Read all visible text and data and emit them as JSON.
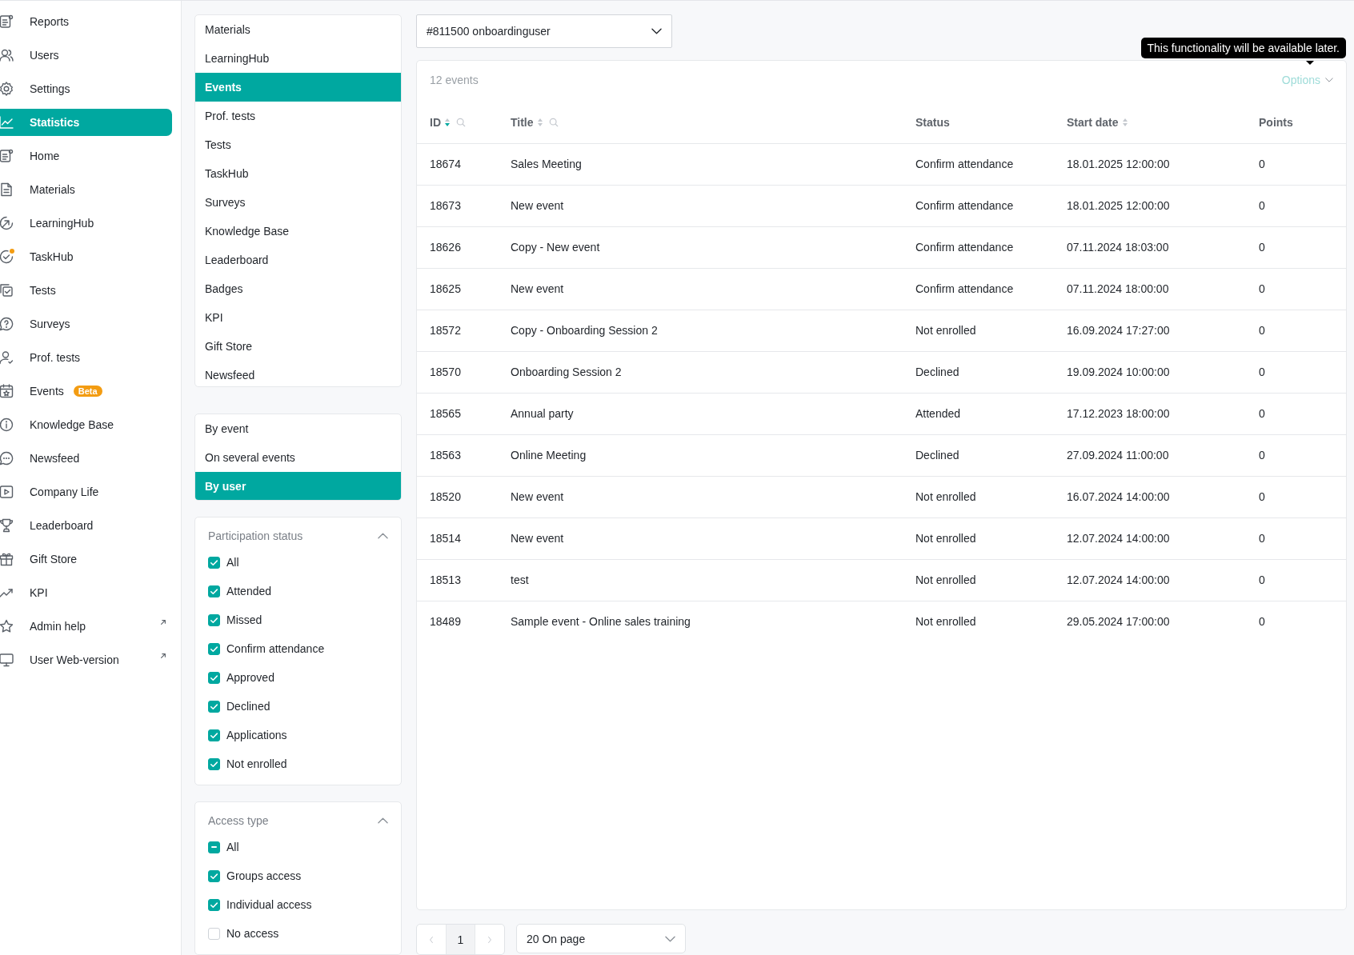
{
  "sidebar": {
    "items": [
      {
        "label": "Reports",
        "selected": false
      },
      {
        "label": "Users",
        "selected": false
      },
      {
        "label": "Settings",
        "selected": false
      },
      {
        "label": "Statistics",
        "selected": true
      },
      {
        "label": "Home",
        "selected": false
      },
      {
        "label": "Materials",
        "selected": false
      },
      {
        "label": "LearningHub",
        "selected": false
      },
      {
        "label": "TaskHub",
        "selected": false,
        "notification": true
      },
      {
        "label": "Tests",
        "selected": false
      },
      {
        "label": "Surveys",
        "selected": false
      },
      {
        "label": "Prof. tests",
        "selected": false
      },
      {
        "label": "Events",
        "selected": false,
        "badge": "Beta"
      },
      {
        "label": "Knowledge Base",
        "selected": false
      },
      {
        "label": "Newsfeed",
        "selected": false
      },
      {
        "label": "Company Life",
        "selected": false
      },
      {
        "label": "Leaderboard",
        "selected": false
      },
      {
        "label": "Gift Store",
        "selected": false
      },
      {
        "label": "KPI",
        "selected": false
      },
      {
        "label": "Admin help",
        "selected": false,
        "external": true
      },
      {
        "label": "User Web-version",
        "selected": false,
        "external": true
      }
    ]
  },
  "sections": {
    "items": [
      {
        "label": "Materials",
        "selected": false
      },
      {
        "label": "LearningHub",
        "selected": false
      },
      {
        "label": "Events",
        "selected": true
      },
      {
        "label": "Prof. tests",
        "selected": false
      },
      {
        "label": "Tests",
        "selected": false
      },
      {
        "label": "TaskHub",
        "selected": false
      },
      {
        "label": "Surveys",
        "selected": false
      },
      {
        "label": "Knowledge Base",
        "selected": false
      },
      {
        "label": "Leaderboard",
        "selected": false
      },
      {
        "label": "Badges",
        "selected": false
      },
      {
        "label": "KPI",
        "selected": false
      },
      {
        "label": "Gift Store",
        "selected": false
      },
      {
        "label": "Newsfeed",
        "selected": false
      }
    ]
  },
  "report_modes": {
    "items": [
      {
        "label": "By event",
        "selected": false
      },
      {
        "label": "On several events",
        "selected": false
      },
      {
        "label": "By user",
        "selected": true
      }
    ]
  },
  "filters": [
    {
      "title": "Participation status",
      "expanded": true,
      "options": [
        {
          "label": "All",
          "checked": true,
          "indeterminate": false
        },
        {
          "label": "Attended",
          "checked": true,
          "indeterminate": false
        },
        {
          "label": "Missed",
          "checked": true,
          "indeterminate": false
        },
        {
          "label": "Confirm attendance",
          "checked": true,
          "indeterminate": false
        },
        {
          "label": "Approved",
          "checked": true,
          "indeterminate": false
        },
        {
          "label": "Declined",
          "checked": true,
          "indeterminate": false
        },
        {
          "label": "Applications",
          "checked": true,
          "indeterminate": false
        },
        {
          "label": "Not enrolled",
          "checked": true,
          "indeterminate": false
        }
      ]
    },
    {
      "title": "Access type",
      "expanded": true,
      "options": [
        {
          "label": "All",
          "checked": false,
          "indeterminate": true
        },
        {
          "label": "Groups access",
          "checked": true,
          "indeterminate": false
        },
        {
          "label": "Individual access",
          "checked": true,
          "indeterminate": false
        },
        {
          "label": "No access",
          "checked": false,
          "indeterminate": false
        }
      ]
    }
  ],
  "user_select": {
    "value": "#811500 onboardinguser"
  },
  "table": {
    "count": "12 events",
    "options": {
      "label": "Options",
      "disabled": true
    },
    "tooltip": "This functionality will be available later.",
    "columns": [
      {
        "label": "ID",
        "sortable": true,
        "sorted": true,
        "searchable": true
      },
      {
        "label": "Title",
        "sortable": true,
        "sorted": false,
        "searchable": true
      },
      {
        "label": "Status",
        "sortable": false,
        "searchable": false
      },
      {
        "label": "Start date",
        "sortable": true,
        "sorted": false,
        "searchable": false
      },
      {
        "label": "Points",
        "sortable": false,
        "searchable": false
      }
    ],
    "rows": [
      [
        "18674",
        "Sales Meeting",
        "Confirm attendance",
        "18.01.2025 12:00:00",
        "0"
      ],
      [
        "18673",
        "New event",
        "Confirm attendance",
        "18.01.2025 12:00:00",
        "0"
      ],
      [
        "18626",
        "Copy - New event",
        "Confirm attendance",
        "07.11.2024 18:03:00",
        "0"
      ],
      [
        "18625",
        "New event",
        "Confirm attendance",
        "07.11.2024 18:00:00",
        "0"
      ],
      [
        "18572",
        "Copy - Onboarding Session 2",
        "Not enrolled",
        "16.09.2024 17:27:00",
        "0"
      ],
      [
        "18570",
        "Onboarding Session 2",
        "Declined",
        "19.09.2024 10:00:00",
        "0"
      ],
      [
        "18565",
        "Annual party",
        "Attended",
        "17.12.2023 18:00:00",
        "0"
      ],
      [
        "18563",
        "Online Meeting",
        "Declined",
        "27.09.2024 11:00:00",
        "0"
      ],
      [
        "18520",
        "New event",
        "Not enrolled",
        "16.07.2024 14:00:00",
        "0"
      ],
      [
        "18514",
        "New event",
        "Not enrolled",
        "12.07.2024 14:00:00",
        "0"
      ],
      [
        "18513",
        "test",
        "Not enrolled",
        "12.07.2024 14:00:00",
        "0"
      ],
      [
        "18489",
        "Sample event - Online sales training",
        "Not enrolled",
        "29.05.2024 17:00:00",
        "0"
      ]
    ]
  },
  "pagination": {
    "pages": [
      {
        "label": "1",
        "selected": true
      }
    ],
    "page_size": "20 On page"
  }
}
